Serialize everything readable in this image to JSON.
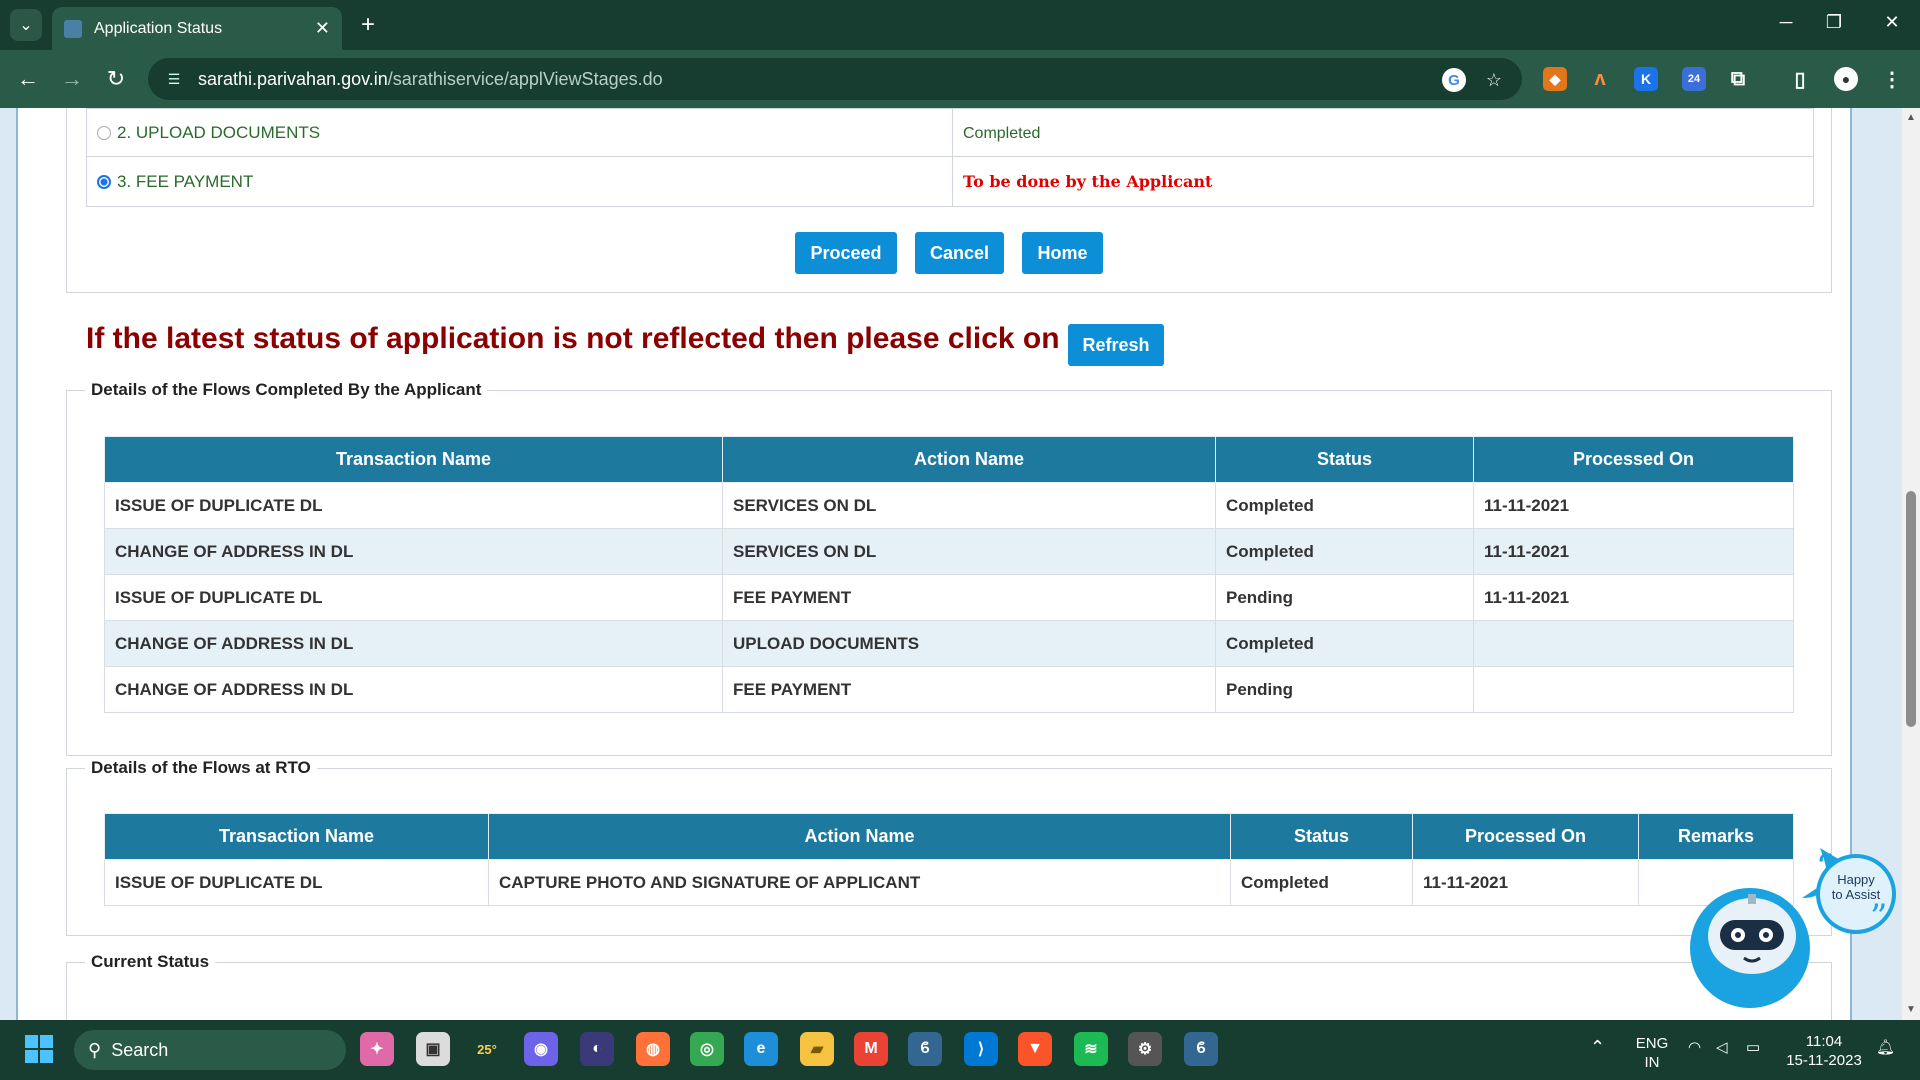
{
  "browser": {
    "tab_title": "Application Status",
    "tab_close": "✕",
    "new_tab": "+",
    "url_host": "sarathi.parivahan.gov.in",
    "url_path": "/sarathiservice/applViewStages.do"
  },
  "stages": [
    {
      "label": "2.  UPLOAD DOCUMENTS",
      "status": "Completed",
      "selected": false
    },
    {
      "label": "3.  FEE PAYMENT",
      "status": "To be done by the Applicant",
      "selected": true
    }
  ],
  "actions": {
    "proceed": "Proceed",
    "cancel": "Cancel",
    "home": "Home"
  },
  "refresh_notice": {
    "text": "If the latest status of application is not reflected then please click on",
    "button": "Refresh"
  },
  "applicant_flows": {
    "legend": "Details of the Flows Completed By the Applicant",
    "headers": [
      "Transaction Name",
      "Action Name",
      "Status",
      "Processed On"
    ],
    "rows": [
      [
        "ISSUE OF DUPLICATE DL",
        "SERVICES ON DL",
        "Completed",
        "11-11-2021"
      ],
      [
        "CHANGE OF ADDRESS IN DL",
        "SERVICES ON DL",
        "Completed",
        "11-11-2021"
      ],
      [
        "ISSUE OF DUPLICATE DL",
        "FEE PAYMENT",
        "Pending",
        "11-11-2021"
      ],
      [
        "CHANGE OF ADDRESS IN DL",
        "UPLOAD DOCUMENTS",
        "Completed",
        ""
      ],
      [
        "CHANGE OF ADDRESS IN DL",
        "FEE PAYMENT",
        "Pending",
        ""
      ]
    ]
  },
  "rto_flows": {
    "legend": "Details of the Flows at RTO",
    "headers": [
      "Transaction Name",
      "Action Name",
      "Status",
      "Processed On",
      "Remarks"
    ],
    "rows": [
      [
        "ISSUE OF DUPLICATE DL",
        "CAPTURE PHOTO AND SIGNATURE OF APPLICANT",
        "Completed",
        "11-11-2021",
        ""
      ]
    ]
  },
  "current_status": {
    "legend": "Current Status"
  },
  "assistant": {
    "line1": "Happy",
    "line2": "to Assist"
  },
  "taskbar": {
    "search": "Search",
    "weather": "25°",
    "lang1": "ENG",
    "lang2": "IN",
    "time": "11:04",
    "date": "15-11-2023"
  },
  "colors": {
    "header_blue": "#1d7a9e",
    "button_blue": "#0d8fd8",
    "notice_red": "#8b0000",
    "todo_red": "#e00000",
    "completed_green": "#2b6a2b"
  }
}
